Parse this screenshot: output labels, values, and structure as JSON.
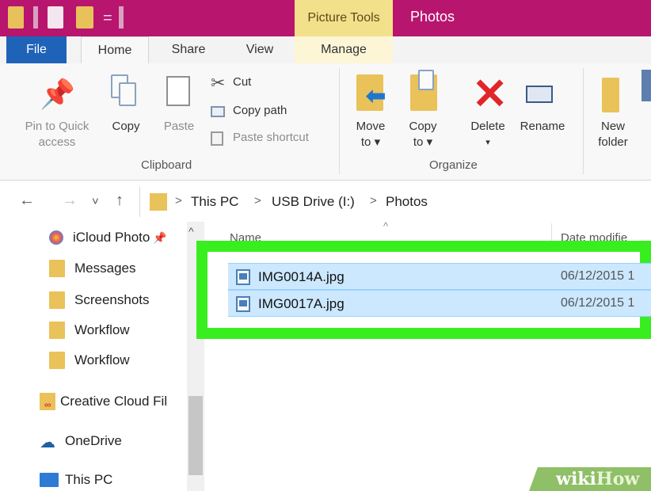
{
  "window": {
    "context_tab": "Picture Tools",
    "title": "Photos"
  },
  "ribbon_tabs": {
    "file": "File",
    "home": "Home",
    "share": "Share",
    "view": "View",
    "manage": "Manage"
  },
  "clipboard": {
    "pin_line1": "Pin to Quick",
    "pin_line2": "access",
    "copy": "Copy",
    "paste": "Paste",
    "cut": "Cut",
    "copy_path": "Copy path",
    "paste_shortcut": "Paste shortcut",
    "group_label": "Clipboard"
  },
  "organize": {
    "move_line1": "Move",
    "move_line2": "to ▾",
    "copy_line1": "Copy",
    "copy_line2": "to ▾",
    "delete": "Delete",
    "delete_arrow": "▾",
    "rename": "Rename",
    "group_label": "Organize"
  },
  "new_group": {
    "new_line1": "New",
    "new_line2": "folder"
  },
  "address": {
    "back": "←",
    "forward": "→",
    "recent": "˅",
    "up": "↑",
    "sep": ">",
    "crumbs": [
      "This PC",
      "USB Drive (I:)",
      "Photos"
    ]
  },
  "sidebar": {
    "items": [
      {
        "label": "iCloud Photo",
        "icon": "icloud-photos-icon"
      },
      {
        "label": "Messages",
        "icon": "folder-icon"
      },
      {
        "label": "Screenshots",
        "icon": "folder-icon"
      },
      {
        "label": "Workflow",
        "icon": "folder-icon"
      },
      {
        "label": "Workflow",
        "icon": "folder-icon"
      },
      {
        "label": "Creative Cloud Fil",
        "icon": "creative-cloud-icon"
      },
      {
        "label": "OneDrive",
        "icon": "onedrive-icon"
      },
      {
        "label": "This PC",
        "icon": "computer-icon"
      }
    ],
    "scroll_up": "^"
  },
  "columns": {
    "name": "Name",
    "date": "Date modifie",
    "sort_indicator": "^"
  },
  "files": [
    {
      "name": "IMG0014A.jpg",
      "date": "06/12/2015 1"
    },
    {
      "name": "IMG0017A.jpg",
      "date": "06/12/2015 1"
    }
  ],
  "watermark": {
    "wiki": "wiki",
    "how": "How"
  },
  "colors": {
    "title_bar": "#b8156f",
    "context_tab": "#f3e08a",
    "file_tab": "#1f63b9",
    "highlight_border": "#39ee1f",
    "selection": "#cce8ff"
  }
}
